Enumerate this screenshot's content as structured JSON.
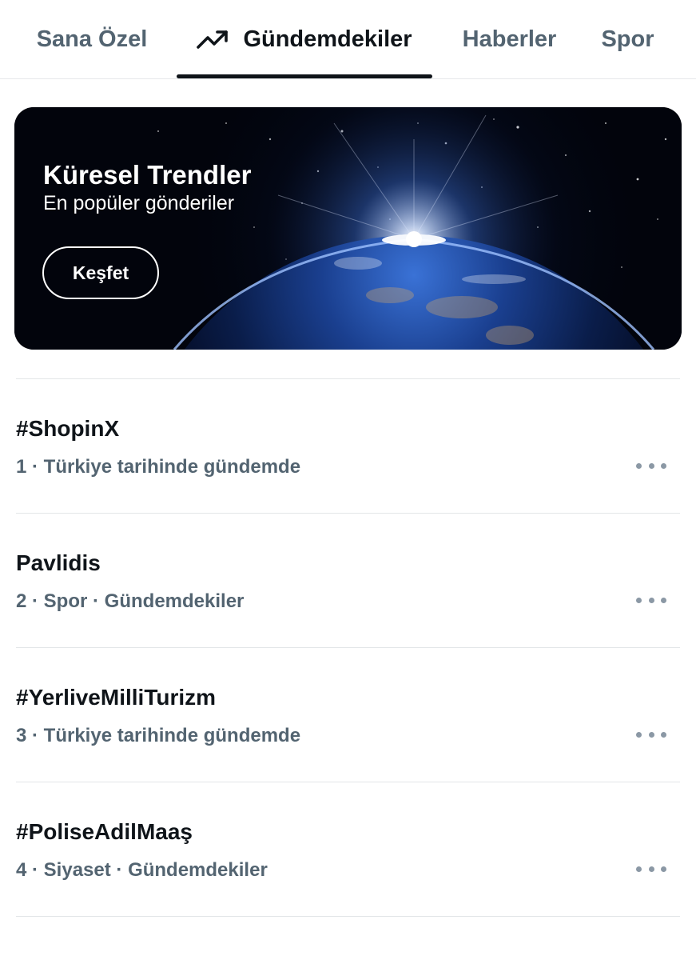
{
  "tabs": [
    {
      "label": "Sana Özel",
      "active": false
    },
    {
      "label": "Gündemdekiler",
      "active": true,
      "icon": "trending-up-icon"
    },
    {
      "label": "Haberler",
      "active": false
    },
    {
      "label": "Spor",
      "active": false
    }
  ],
  "banner": {
    "title": "Küresel Trendler",
    "subtitle": "En popüler gönderiler",
    "button_label": "Keşfet",
    "image": "earth-from-space-with-sunrise"
  },
  "trends": [
    {
      "name": "#ShopinX",
      "meta": "1 · Türkiye tarihinde gündemde"
    },
    {
      "name": "Pavlidis",
      "meta": "2 · Spor · Gündemdekiler"
    },
    {
      "name": "#YerliveMilliTurizm",
      "meta": "3 · Türkiye tarihinde gündemde"
    },
    {
      "name": "#PoliseAdilMaaş",
      "meta": "4 · Siyaset · Gündemdekiler"
    }
  ],
  "colors": {
    "text_primary": "#0f1419",
    "text_secondary": "#536471",
    "divider": "#e3e6e8",
    "dots": "#8b98a5"
  }
}
